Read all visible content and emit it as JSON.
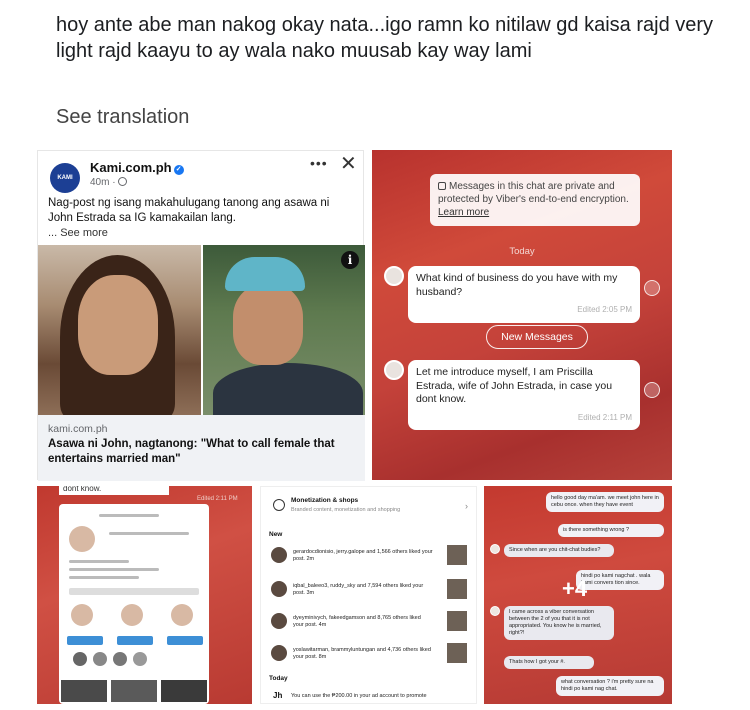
{
  "post": {
    "text": "hoy ante abe man nakog okay nata...igo ramn ko nitilaw gd kaisa rajd very light rajd kaayu to ay wala nako muusab kay way lami",
    "see_translation": "See translation"
  },
  "fb_card": {
    "page_name": "Kami.com.ph",
    "avatar_text": "KAMI",
    "time": "40m ·",
    "more": "•••",
    "close": "✕",
    "caption": "Nag-post ng isang makahulugang tanong ang asawa ni John Estrada sa IG kamakailan lang.",
    "see_more": "... See more",
    "info": "i",
    "link_domain": "kami.com.ph",
    "link_headline": "Asawa ni John, nagtanong: \"What to call female that entertains married man\""
  },
  "viber": {
    "notice_line1": "Messages in this chat are private and protected by Viber's end-to-end encryption.",
    "learn_more": "Learn more",
    "today": "Today",
    "msg1": "What kind of business do you have with my husband?",
    "msg1_edited": "Edited 2:05 PM",
    "new_messages": "New Messages",
    "msg2": "Let me introduce myself, I am Priscilla Estrada, wife of John Estrada, in case you dont know.",
    "msg2_edited": "Edited 2:11 PM"
  },
  "ig_screen": {
    "dont_know": "dont know.",
    "edited": "Edited 2:11 PM"
  },
  "notifications": {
    "title": "Monetization & shops",
    "subtitle": "Branded content, monetization and shopping",
    "new_label": "New",
    "rows": [
      "gerardocdionisio, jerry.galope and 1,566 others liked your post. 2m",
      "iqbal_baleeo3, ruddy_sky and 7,594 others liked your post. 3m",
      "dyeyminivych, fakeedgamson and 8,765 others liked your post. 4m",
      "yoslawitarman, brammyluntungan and 4,736 others liked your post. 8m"
    ],
    "today_label": "Today",
    "bottom_text": "You can use the ₱200.00 in your ad account to promote"
  },
  "messenger": {
    "msgs": [
      "hello good day ma'am. we meet john here in cebu once. when they have event",
      "is there something wrong ?",
      "Since when are you chit-chat budies?",
      "hindi po kami nagchat . wala kami convers tion since.",
      "I came across a viber conversation between the 2 of you that it is not appropriated. You know he is married, right?!",
      "Thats how I got your #.",
      "what conversation ? i'm pretty sure na hindi po kami nag chat."
    ],
    "plus": "+4"
  }
}
